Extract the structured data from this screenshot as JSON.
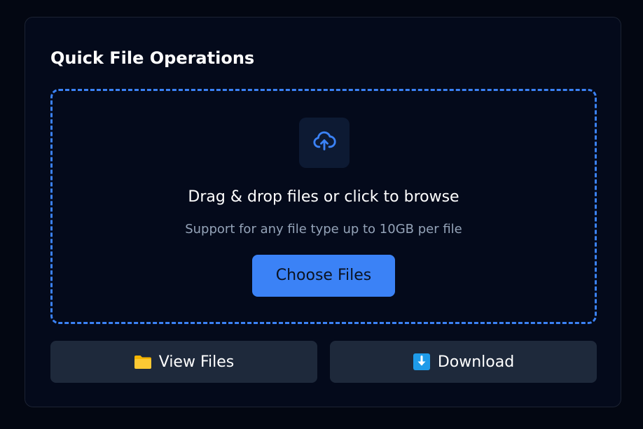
{
  "card": {
    "title": "Quick File Operations"
  },
  "dropzone": {
    "icon": "cloud-upload-icon",
    "title": "Drag & drop files or click to browse",
    "subtitle": "Support for any file type up to 10GB per file",
    "button_label": "Choose Files"
  },
  "actions": [
    {
      "label": "View Files",
      "icon": "folder-icon"
    },
    {
      "label": "Download",
      "icon": "download-arrow-icon"
    }
  ],
  "colors": {
    "page_background": "#030712",
    "card_background": "#040a1b",
    "accent": "#3b82f6",
    "secondary_button": "#1e293b",
    "muted_text": "#94a3b8",
    "folder": "#fcc934"
  }
}
